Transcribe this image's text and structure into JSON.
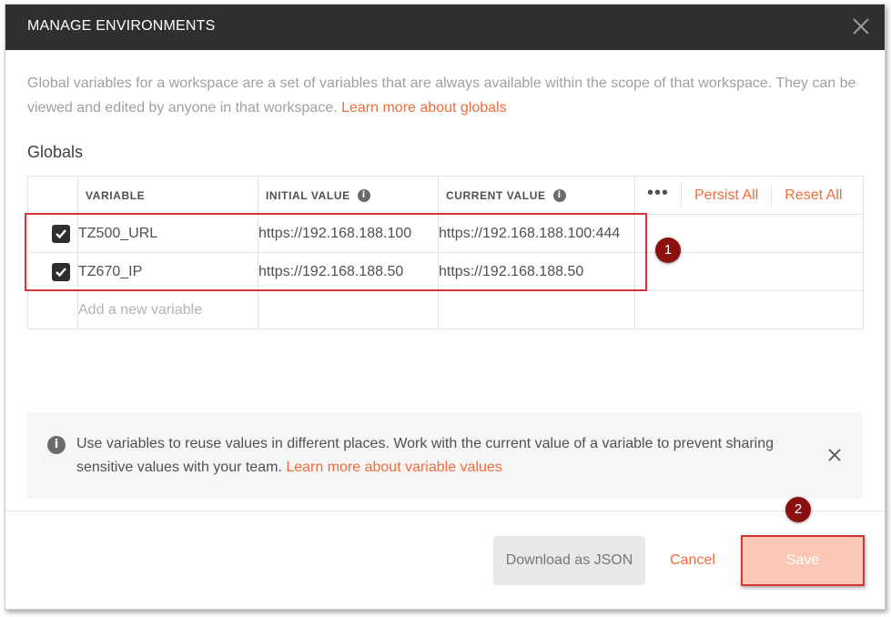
{
  "dialog": {
    "title": "MANAGE ENVIRONMENTS",
    "close_icon": "close-icon"
  },
  "intro": {
    "text": "Global variables for a workspace are a set of variables that are always available within the scope of that workspace. They can be viewed and edited by anyone in that workspace. ",
    "link": "Learn more about globals"
  },
  "globals": {
    "section_title": "Globals",
    "columns": {
      "variable": "VARIABLE",
      "initial_value": "INITIAL VALUE",
      "current_value": "CURRENT VALUE"
    },
    "actions": {
      "more": "•••",
      "persist_all": "Persist All",
      "reset_all": "Reset All"
    },
    "rows": [
      {
        "enabled": true,
        "variable": "TZ500_URL",
        "initial_value": "https://192.168.188.100",
        "current_value": "https://192.168.188.100:444"
      },
      {
        "enabled": true,
        "variable": "TZ670_IP",
        "initial_value": "https://192.168.188.50",
        "current_value": "https://192.168.188.50"
      }
    ],
    "new_row_placeholder": "Add a new variable"
  },
  "notice": {
    "icon": "info-icon",
    "text": "Use variables to reuse values in different places. Work with the current value of a variable to prevent sharing sensitive values with your team. ",
    "link": "Learn more about variable values"
  },
  "footer": {
    "download_label": "Download as JSON",
    "cancel_label": "Cancel",
    "save_label": "Save"
  },
  "annotations": {
    "badge_1": "1",
    "badge_2": "2"
  },
  "colors": {
    "accent": "#f26b3a",
    "titlebar": "#2f2f2f",
    "highlight": "#d9333a",
    "badge": "#8b1010"
  }
}
